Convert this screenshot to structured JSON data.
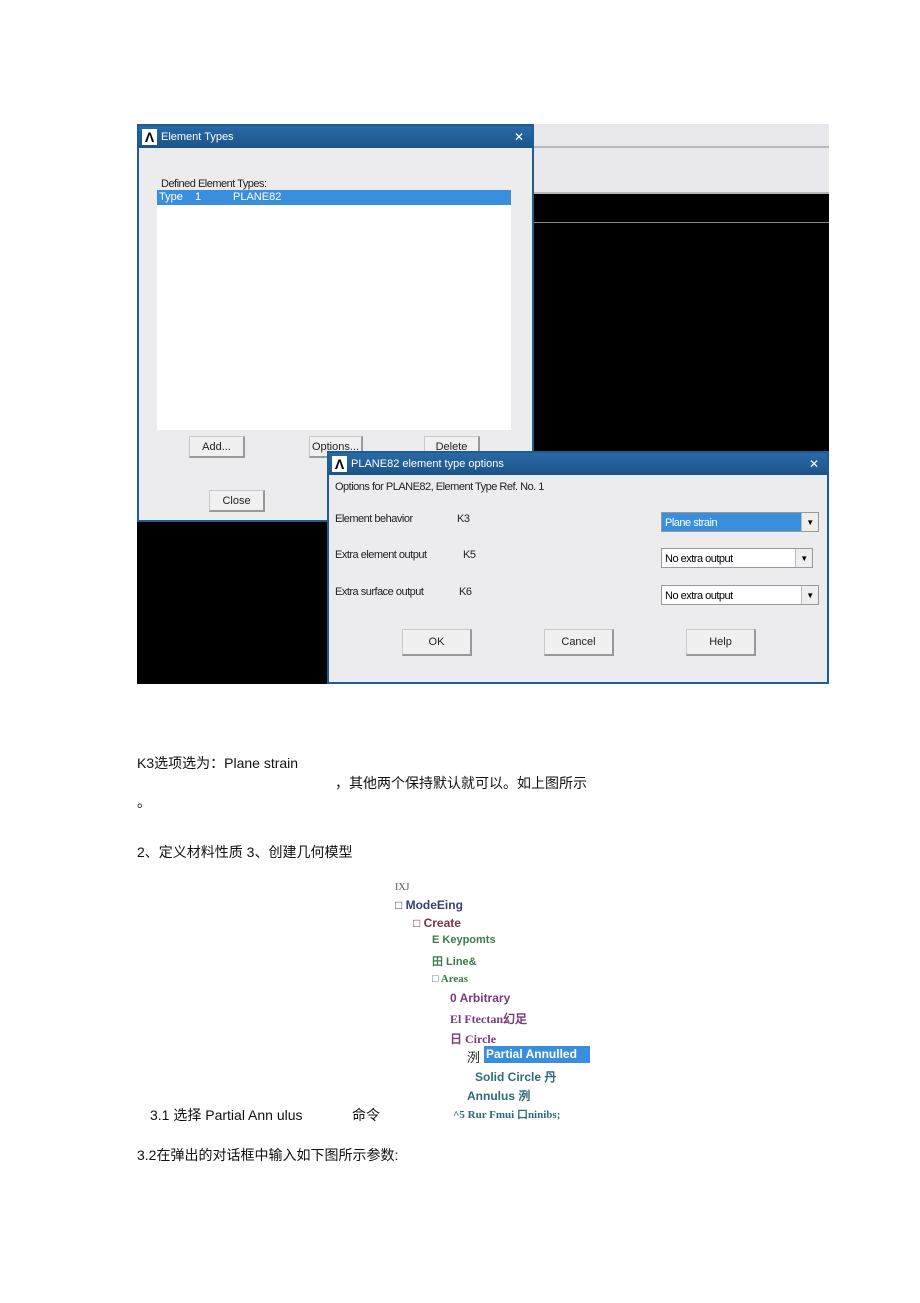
{
  "element_types_dialog": {
    "title": "Element Types",
    "close_glyph": "✕",
    "list_label": "Defined Element Types:",
    "items": [
      {
        "type": "Type",
        "num": "1",
        "name": "PLANE82"
      }
    ],
    "buttons": {
      "add": "Add...",
      "options": "Options...",
      "delete": "Delete",
      "close": "Close"
    }
  },
  "options_dialog": {
    "title": "PLANE82 element type options",
    "close_glyph": "✕",
    "subtitle": "Options for PLANE82, Element Type Ref. No. 1",
    "rows": [
      {
        "label": "Element behavior",
        "key": "K3",
        "value": "Plane strain"
      },
      {
        "label": "Extra element output",
        "key": "K5",
        "value": "No extra output"
      },
      {
        "label": "Extra surface output",
        "key": "K6",
        "value": "No extra output"
      }
    ],
    "buttons": {
      "ok": "OK",
      "cancel": "Cancel",
      "help": "Help"
    },
    "accent": "#3a8fdc"
  },
  "doc": {
    "line1": "K3选项选为：Plane strain",
    "line2": "，其他两个保持默认就可以。如上图所示",
    "line3": "。",
    "line4": "2、定义材料性质 3、创建几何模型",
    "line5a": "3.1 选择  Partial Ann ulus",
    "line5b": "命令",
    "line6": "3.2在弹出的对话框中输入如下图所示参数:"
  },
  "tree": {
    "header": "IXJ",
    "items": [
      "□ ModeEing",
      "□ Create",
      "E Keypomts",
      "田  Line&",
      "□ Areas",
      "0 Arbitrary",
      "El Ftectan幻足",
      "日  Circle",
      "洌",
      "Partial Annulled",
      "Solid Circle 丹",
      "Annulus 洌",
      "^5 Rur Fmui 口ninibs;"
    ]
  }
}
